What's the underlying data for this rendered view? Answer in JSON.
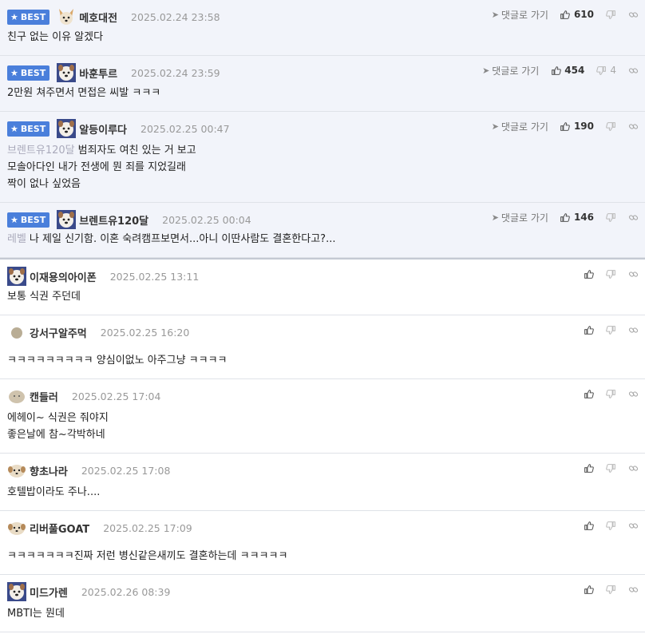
{
  "best_label": "BEST",
  "goto_label": "댓글로 가기",
  "best_comments": [
    {
      "nick": "메호대전",
      "date": "2025.02.24 23:58",
      "up": "610",
      "down": "",
      "lines": [
        "친구 없는 이유 알겠다"
      ],
      "quote": ""
    },
    {
      "nick": "바훈투르",
      "date": "2025.02.24 23:59",
      "up": "454",
      "down": "4",
      "lines": [
        "2만원 쳐주면서 면접은 씨발 ㅋㅋㅋ"
      ],
      "quote": ""
    },
    {
      "nick": "알등이루다",
      "date": "2025.02.25 00:47",
      "up": "190",
      "down": "",
      "lines": [
        "범죄자도 여친 있는 거 보고",
        "모솔아다인 내가 전생에 뭔 죄를 지었길래",
        "짝이 없나 싶었음"
      ],
      "quote": "브렌트유120달"
    },
    {
      "nick": "브렌트유120달",
      "date": "2025.02.25 00:04",
      "up": "146",
      "down": "",
      "lines": [
        "나 제일 신기함. 이혼 숙려캠프보면서...아니 이딴사람도 결혼한다고?..."
      ],
      "quote": "레벨"
    }
  ],
  "comments": [
    {
      "nick": "이재용의아이폰",
      "date": "2025.02.25 13:11",
      "lines": [
        "보통 식권 주던데"
      ],
      "avatar": "dog"
    },
    {
      "nick": "강서구알주먹",
      "date": "2025.02.25 16:20",
      "lines": [
        "ㅋㅋㅋㅋㅋㅋㅋㅋㅋ 양심이없노 아주그냥 ㅋㅋㅋㅋ"
      ],
      "avatar": "dot"
    },
    {
      "nick": "캔들러",
      "date": "2025.02.25 17:04",
      "lines": [
        "에헤이~ 식권은 줘야지",
        "좋은날에 참~각박하네"
      ],
      "avatar": "blob"
    },
    {
      "nick": "향초나라",
      "date": "2025.02.25 17:08",
      "lines": [
        "호텔밥이라도 주나...."
      ],
      "avatar": "pup"
    },
    {
      "nick": "리버풀GOAT",
      "date": "2025.02.25 17:09",
      "lines": [
        "ㅋㅋㅋㅋㅋㅋㅋ진짜 저런 병신같은새끼도 결혼하는데 ㅋㅋㅋㅋㅋ"
      ],
      "avatar": "pup"
    },
    {
      "nick": "미드가렌",
      "date": "2025.02.26 08:39",
      "lines": [
        "MBTI는 뭔데"
      ],
      "avatar": "dog"
    }
  ]
}
